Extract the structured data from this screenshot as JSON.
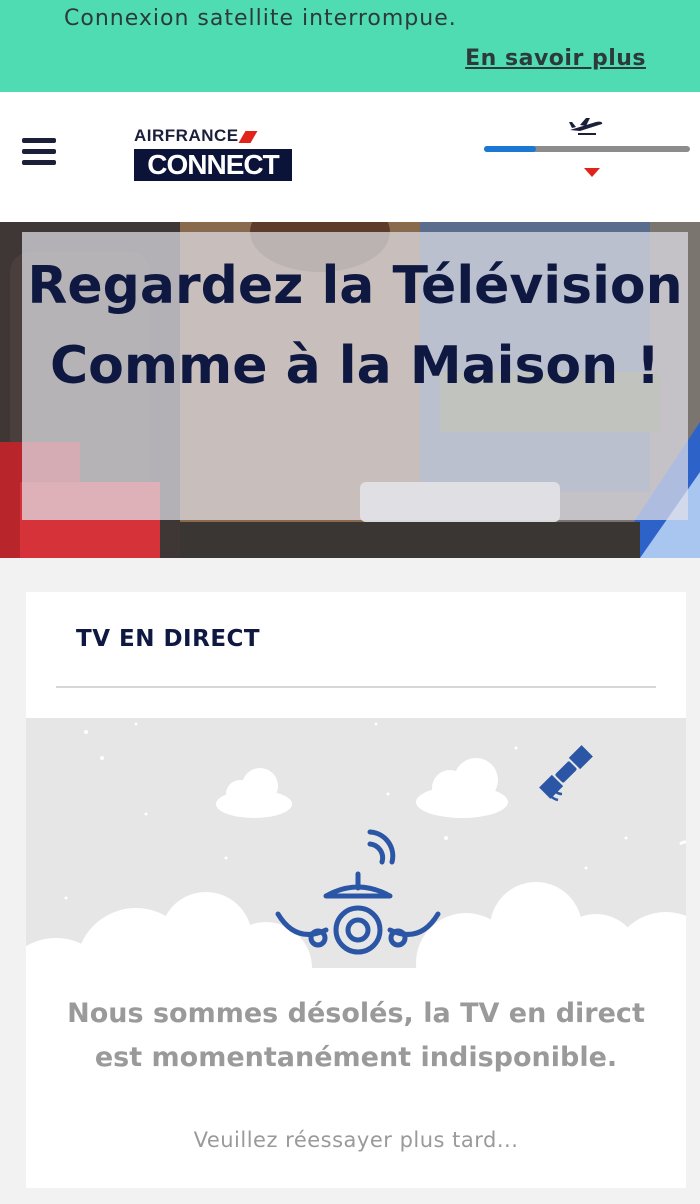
{
  "banner": {
    "message": "Connexion satellite interrompue.",
    "link": "En savoir plus",
    "color": "#4fdcb2"
  },
  "header": {
    "logo_top": "AIRFRANCE",
    "logo_bottom": "CONNECT",
    "menu_icon": "hamburger-menu-icon",
    "flight_icon": "airplane-takeoff-icon",
    "flight_progress": 0.25,
    "accent_color": "#1b78d2",
    "marker_color": "#e2231a"
  },
  "hero": {
    "title": "Regardez la Télévision Comme à la Maison !"
  },
  "tv_card": {
    "title": "TV EN DIRECT",
    "error_message": "Nous sommes désolés, la TV en direct est momentanément indisponible.",
    "retry_message": "Veuillez réessayer plus tard...",
    "icons": [
      "satellite-icon",
      "airplane-wifi-icon",
      "cloud-icon"
    ],
    "illustration_color": "#2b56a6"
  }
}
